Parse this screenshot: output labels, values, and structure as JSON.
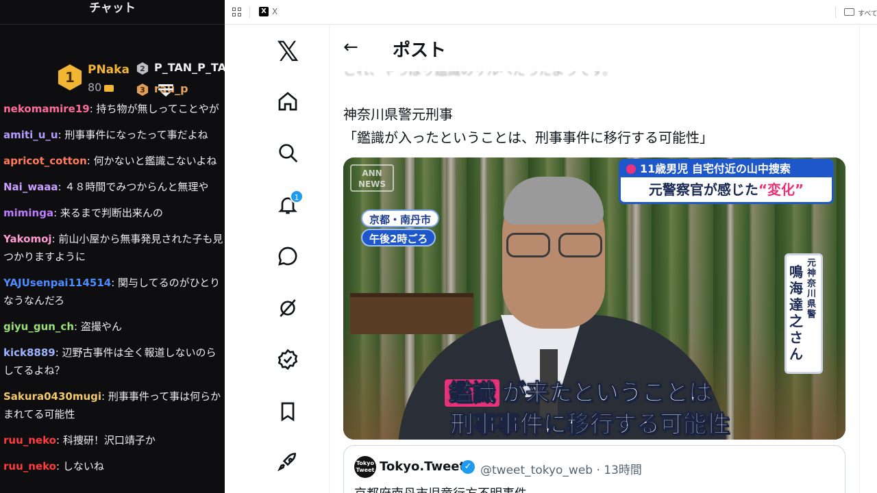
{
  "chat": {
    "title": "チャット",
    "leaderboard": {
      "first": {
        "rank": "1",
        "name": "PNaka",
        "score": "80"
      },
      "second": {
        "rank": "2",
        "name": "P_TAN_P_TA"
      },
      "third": {
        "rank": "3",
        "name": "rau_p"
      }
    },
    "messages": [
      {
        "user": "nekomamire19",
        "color": "#ff6b9a",
        "text": ": 持ち物が無しってことやが"
      },
      {
        "user": "amiti_u_u",
        "color": "#b69cff",
        "text": ": 刑事事件になったって事だよね"
      },
      {
        "user": "apricot_cotton",
        "color": "#ff7a5c",
        "text": ": 何かないと鑑識こないよね"
      },
      {
        "user": "Nai_waaa",
        "color": "#c9a0ff",
        "text": ": ４８時間でみつからんと無理や"
      },
      {
        "user": "mimingа",
        "color": "#c07cff",
        "text": ": 来るまで判断出来んの"
      },
      {
        "user": "Yakomoj",
        "color": "#ff9bd2",
        "text": ": 前山小屋から無事発見された子も見つかりますように"
      },
      {
        "user": "YAJUsenpai114514",
        "color": "#4d8dff",
        "text": ": 関与してるのがひとりなうなんだろ"
      },
      {
        "user": "giyu_gun_ch",
        "color": "#9be07a",
        "text": ": 盗撮やん"
      },
      {
        "user": "kick8889",
        "color": "#9fb4ff",
        "text": ": 辺野古事件は全く報道しないのらしてるよね？"
      },
      {
        "user": "Sakura0430mugi",
        "color": "#f2c96b",
        "text": ": 刑事事件って事は何らかまれてる可能性"
      },
      {
        "user": "ruu_neko",
        "color": "#ff3b3b",
        "text": ": 科捜研！沢口靖子か"
      },
      {
        "user": "ruu_neko",
        "color": "#ff3b3b",
        "text": ": しないね"
      }
    ]
  },
  "browser": {
    "tab_label": "X",
    "folder_label": "すべて"
  },
  "x": {
    "logo": "𝕏",
    "notification_count": "1",
    "nav_icons": [
      "home-icon",
      "search-icon",
      "notifications-icon",
      "messages-icon",
      "grok-icon",
      "verified-icon",
      "bookmarks-icon",
      "rocket-icon"
    ],
    "post": {
      "back": "←",
      "title": "ポスト",
      "faded_line": "これ、やっぱり鑑識のサルべたったようです。",
      "body_line1": "神奈川県警元刑事",
      "body_line2": "「鑑識が入ったということは、刑事事件に移行する可能性」",
      "media": {
        "watermark": "ANN NEWS",
        "location": "京都・南丹市",
        "time": "午後2時ごろ",
        "caption_top": "11歳男児 自宅付近の山中捜索",
        "caption_main_prefix": "元警察官が感じた",
        "caption_main_emph": "“変化”",
        "name_small": "元神奈川県警",
        "name_big": "鳴海達之さん",
        "subtitle_hl": "鑑識",
        "subtitle_rest": "が来たということは",
        "subtitle_line2": "刑事事件に移行する可能性"
      },
      "quote": {
        "avatar": "Tokyo Tweet",
        "name": "Tokyo.Tweet",
        "verified": "✓",
        "handle": "@tweet_tokyo_web · 13時間",
        "text": "京都府南丹市児童行方不明事件"
      }
    }
  }
}
